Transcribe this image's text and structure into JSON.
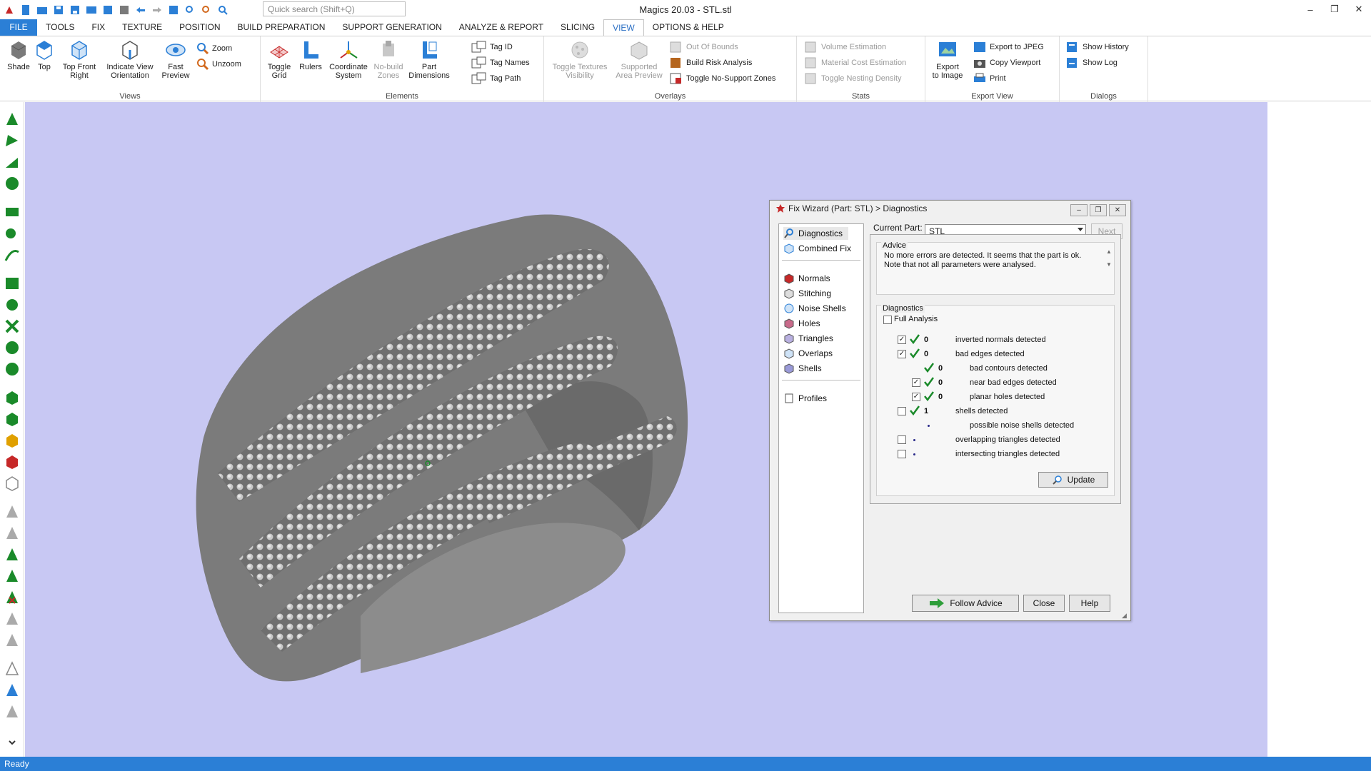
{
  "app": {
    "title": "Magics 20.03 - STL.stl",
    "search_placeholder": "Quick search (Shift+Q)",
    "window_controls": [
      "–",
      "❐",
      "✕"
    ]
  },
  "menu": {
    "tabs": [
      "FILE",
      "TOOLS",
      "FIX",
      "TEXTURE",
      "POSITION",
      "BUILD PREPARATION",
      "SUPPORT GENERATION",
      "ANALYZE & REPORT",
      "SLICING",
      "VIEW",
      "OPTIONS & HELP"
    ],
    "active": "VIEW"
  },
  "ribbon": {
    "views": {
      "label": "Views",
      "shade": "Shade",
      "top": "Top",
      "top_front_right_1": "Top Front",
      "top_front_right_2": "Right",
      "indicate_1": "Indicate View",
      "indicate_2": "Orientation",
      "fast_1": "Fast",
      "fast_2": "Preview",
      "zoom": "Zoom",
      "unzoom": "Unzoom"
    },
    "elements": {
      "label": "Elements",
      "toggle_grid_1": "Toggle",
      "toggle_grid_2": "Grid",
      "rulers": "Rulers",
      "coord_1": "Coordinate",
      "coord_2": "System",
      "nobuild_1": "No-build",
      "nobuild_2": "Zones",
      "partdim_1": "Part",
      "partdim_2": "Dimensions",
      "tag_id": "Tag ID",
      "tag_names": "Tag Names",
      "tag_path": "Tag Path"
    },
    "overlays": {
      "label": "Overlays",
      "toggle_tex_1": "Toggle Textures",
      "toggle_tex_2": "Visibility",
      "supported_1": "Supported",
      "supported_2": "Area Preview",
      "out_of_bounds": "Out Of Bounds",
      "build_risk": "Build Risk Analysis",
      "toggle_nosupport": "Toggle No-Support Zones"
    },
    "stats": {
      "label": "Stats",
      "volume": "Volume Estimation",
      "material": "Material Cost Estimation",
      "nesting": "Toggle Nesting Density"
    },
    "export": {
      "label": "Export View",
      "export_img_1": "Export",
      "export_img_2": "to Image",
      "export_jpeg": "Export to JPEG",
      "copy_viewport": "Copy Viewport",
      "print": "Print"
    },
    "dialogs": {
      "label": "Dialogs",
      "show_history": "Show History",
      "show_log": "Show Log"
    }
  },
  "status": {
    "text": "Ready"
  },
  "dialog": {
    "title": "Fix Wizard (Part: STL) > Diagnostics",
    "nav": [
      "Diagnostics",
      "Combined Fix",
      "Normals",
      "Stitching",
      "Noise Shells",
      "Holes",
      "Triangles",
      "Overlaps",
      "Shells",
      "Profiles"
    ],
    "current_part_label": "Current Part:",
    "current_part_value": "STL",
    "next_label": "Next",
    "advice_label": "Advice",
    "advice_text": "No more errors are detected. It seems that the part is ok. Note that not all parameters were analysed.",
    "diagnostics_label": "Diagnostics",
    "full_analysis": "Full Analysis",
    "rows": [
      {
        "count": "0",
        "label": "inverted normals detected",
        "checked": true,
        "ok": true
      },
      {
        "count": "0",
        "label": "bad edges detected",
        "checked": true,
        "ok": true
      },
      {
        "count": "0",
        "label": "bad contours detected",
        "checked": false,
        "ok": true
      },
      {
        "count": "0",
        "label": "near bad edges detected",
        "checked": true,
        "ok": true
      },
      {
        "count": "0",
        "label": "planar holes detected",
        "checked": true,
        "ok": true
      },
      {
        "count": "1",
        "label": "shells detected",
        "checked": false,
        "ok": true
      },
      {
        "count": "",
        "label": "possible noise shells detected",
        "checked": false,
        "ok": false
      },
      {
        "count": "",
        "label": "overlapping triangles detected",
        "checked": false,
        "ok": false
      },
      {
        "count": "",
        "label": "intersecting triangles detected",
        "checked": false,
        "ok": false
      }
    ],
    "update_label": "Update",
    "follow_advice_label": "Follow Advice",
    "close_label": "Close",
    "help_label": "Help"
  },
  "colors": {
    "accent": "#2b7fd6",
    "viewport_bg": "#c8c8f3",
    "ok_green": "#1a8a2a"
  }
}
